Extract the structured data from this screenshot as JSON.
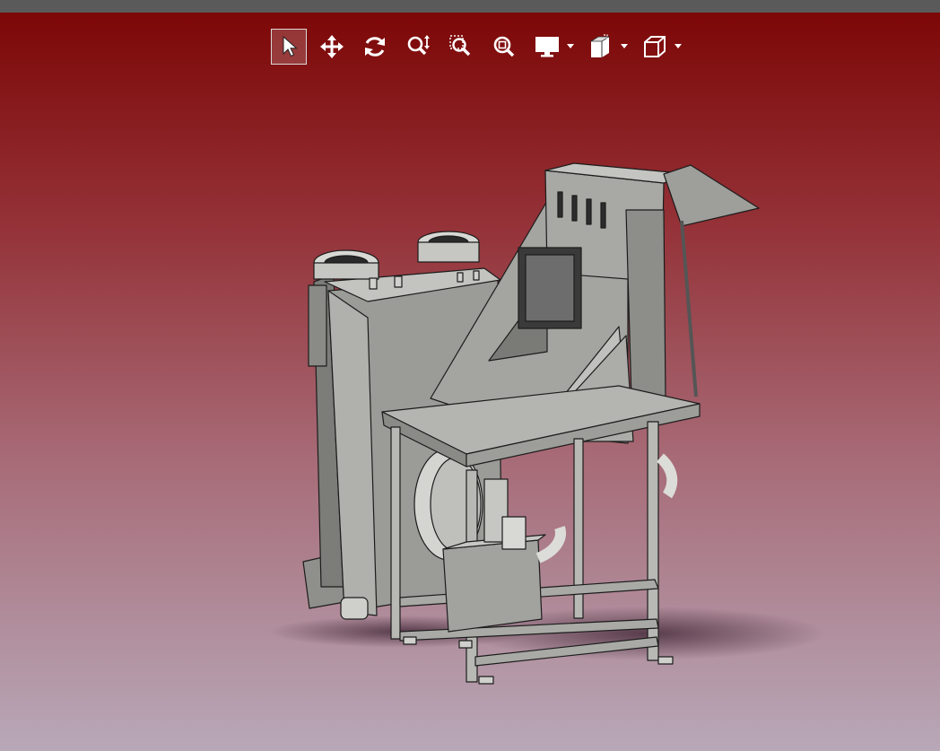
{
  "app": {
    "toolbar": {
      "tools": [
        {
          "name": "select",
          "icon": "cursor-arrow-icon",
          "active": true
        },
        {
          "name": "pan",
          "icon": "move-arrows-icon",
          "active": false
        },
        {
          "name": "rotate",
          "icon": "rotate-icon",
          "active": false
        },
        {
          "name": "zoom",
          "icon": "zoom-updown-icon",
          "active": false
        },
        {
          "name": "zoom-window",
          "icon": "zoom-window-icon",
          "active": false
        },
        {
          "name": "zoom-fit",
          "icon": "zoom-fit-icon",
          "active": false
        }
      ],
      "dropdowns": [
        {
          "name": "display",
          "icon": "monitor-icon"
        },
        {
          "name": "section-view",
          "icon": "section-view-icon"
        },
        {
          "name": "standard-views",
          "icon": "cube-icon"
        }
      ]
    },
    "colors": {
      "titlebar": "#5a5a5a",
      "background_top": "#7d0707",
      "background_bottom": "#b8a8b8",
      "metal": "#9a9a96",
      "icon": "#ffffff"
    }
  }
}
